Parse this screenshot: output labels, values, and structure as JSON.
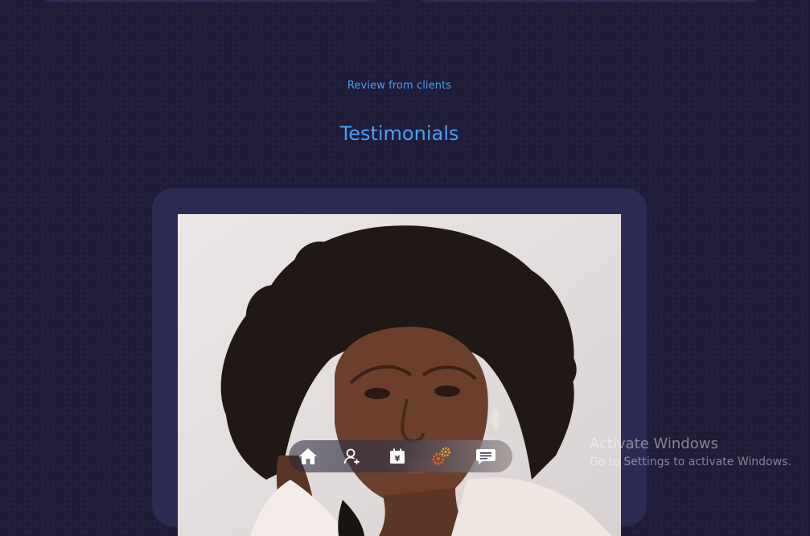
{
  "testimonials": {
    "eyebrow": "Review from clients",
    "title": "Testimonials"
  },
  "bottom_nav": {
    "items": [
      {
        "icon": "home-icon"
      },
      {
        "icon": "add-user-icon"
      },
      {
        "icon": "yen-calendar-icon"
      },
      {
        "icon": "gears-icon"
      },
      {
        "icon": "message-icon"
      }
    ],
    "colors": {
      "icon": "#ffffff",
      "gear_outer": "#e8641e",
      "gear_inner": "#f0a020"
    }
  },
  "watermark": {
    "line1": "Activate Windows",
    "line2": "Go to Settings to activate Windows."
  },
  "colors": {
    "background": "#1e1c38",
    "card": "#2c2a55",
    "accent": "#4d9ef2"
  }
}
